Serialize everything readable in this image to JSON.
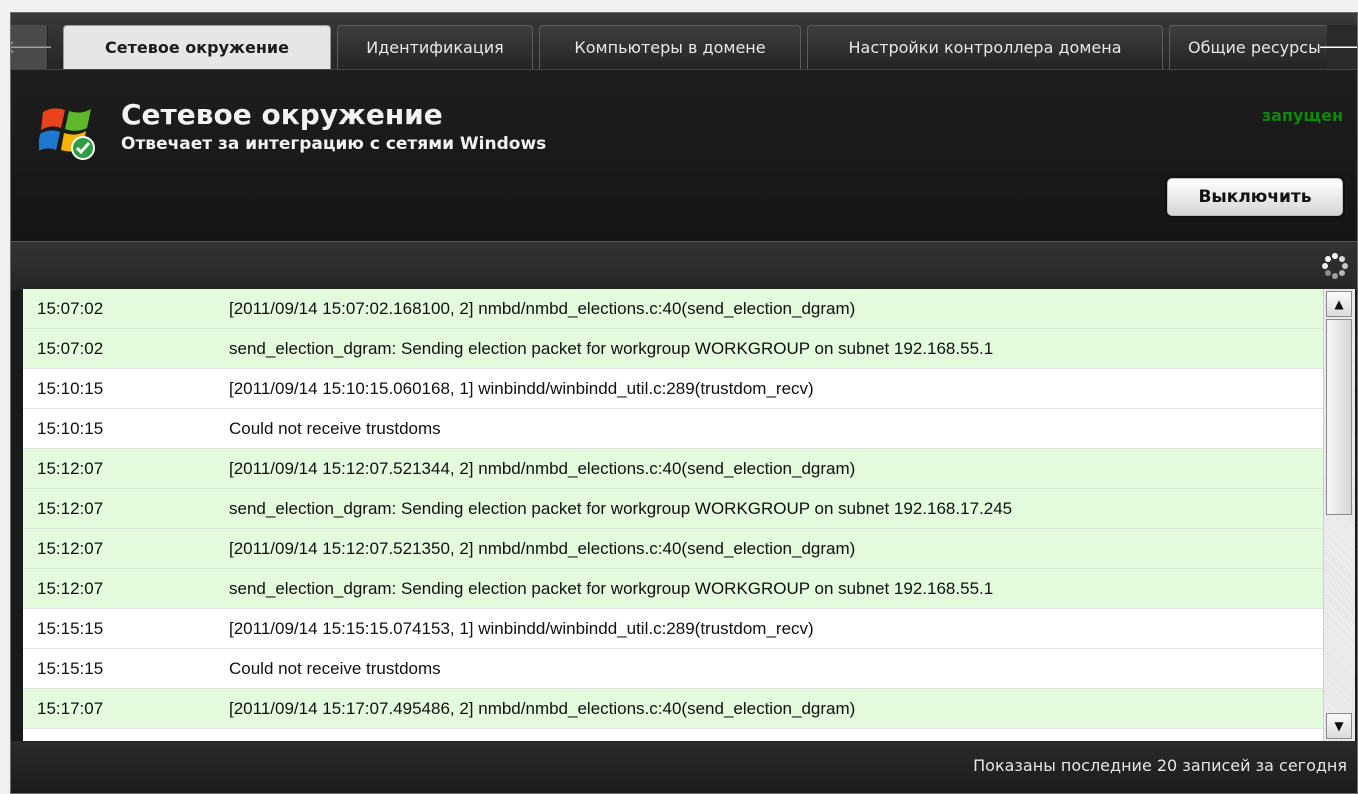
{
  "tabs": [
    {
      "label": "Сетевое окружение",
      "active": true
    },
    {
      "label": "Идентификация",
      "active": false
    },
    {
      "label": "Компьютеры в домене",
      "active": false
    },
    {
      "label": "Настройки контроллера домена",
      "active": false
    },
    {
      "label": "Общие ресурсы",
      "active": false
    }
  ],
  "header": {
    "title": "Сетевое окружение",
    "subtitle": "Отвечает за интеграцию с сетями Windows",
    "status": "запущен",
    "status_color": "#0a8a00",
    "toggle_button": "Выключить"
  },
  "log": {
    "rows": [
      {
        "time": "15:07:02",
        "message": "[2011/09/14 15:07:02.168100, 2] nmbd/nmbd_elections.c:40(send_election_dgram)",
        "highlight": true
      },
      {
        "time": "15:07:02",
        "message": "send_election_dgram: Sending election packet for workgroup WORKGROUP on subnet 192.168.55.1",
        "highlight": true
      },
      {
        "time": "15:10:15",
        "message": "[2011/09/14 15:10:15.060168, 1] winbindd/winbindd_util.c:289(trustdom_recv)",
        "highlight": false
      },
      {
        "time": "15:10:15",
        "message": "Could not receive trustdoms",
        "highlight": false
      },
      {
        "time": "15:12:07",
        "message": "[2011/09/14 15:12:07.521344, 2] nmbd/nmbd_elections.c:40(send_election_dgram)",
        "highlight": true
      },
      {
        "time": "15:12:07",
        "message": "send_election_dgram: Sending election packet for workgroup WORKGROUP on subnet 192.168.17.245",
        "highlight": true
      },
      {
        "time": "15:12:07",
        "message": "[2011/09/14 15:12:07.521350, 2] nmbd/nmbd_elections.c:40(send_election_dgram)",
        "highlight": true
      },
      {
        "time": "15:12:07",
        "message": "send_election_dgram: Sending election packet for workgroup WORKGROUP on subnet 192.168.55.1",
        "highlight": true
      },
      {
        "time": "15:15:15",
        "message": "[2011/09/14 15:15:15.074153, 1] winbindd/winbindd_util.c:289(trustdom_recv)",
        "highlight": false
      },
      {
        "time": "15:15:15",
        "message": "Could not receive trustdoms",
        "highlight": false
      },
      {
        "time": "15:17:07",
        "message": "[2011/09/14 15:17:07.495486, 2] nmbd/nmbd_elections.c:40(send_election_dgram)",
        "highlight": true
      }
    ],
    "highlight_color": "#e3fbdc"
  },
  "footer": {
    "text": "Показаны последние 20 записей за сегодня"
  },
  "icons": {
    "nav_left": "arrow-left-icon",
    "nav_right": "arrow-right-icon",
    "logo": "windows-logo-icon",
    "refresh": "refresh-icon"
  }
}
